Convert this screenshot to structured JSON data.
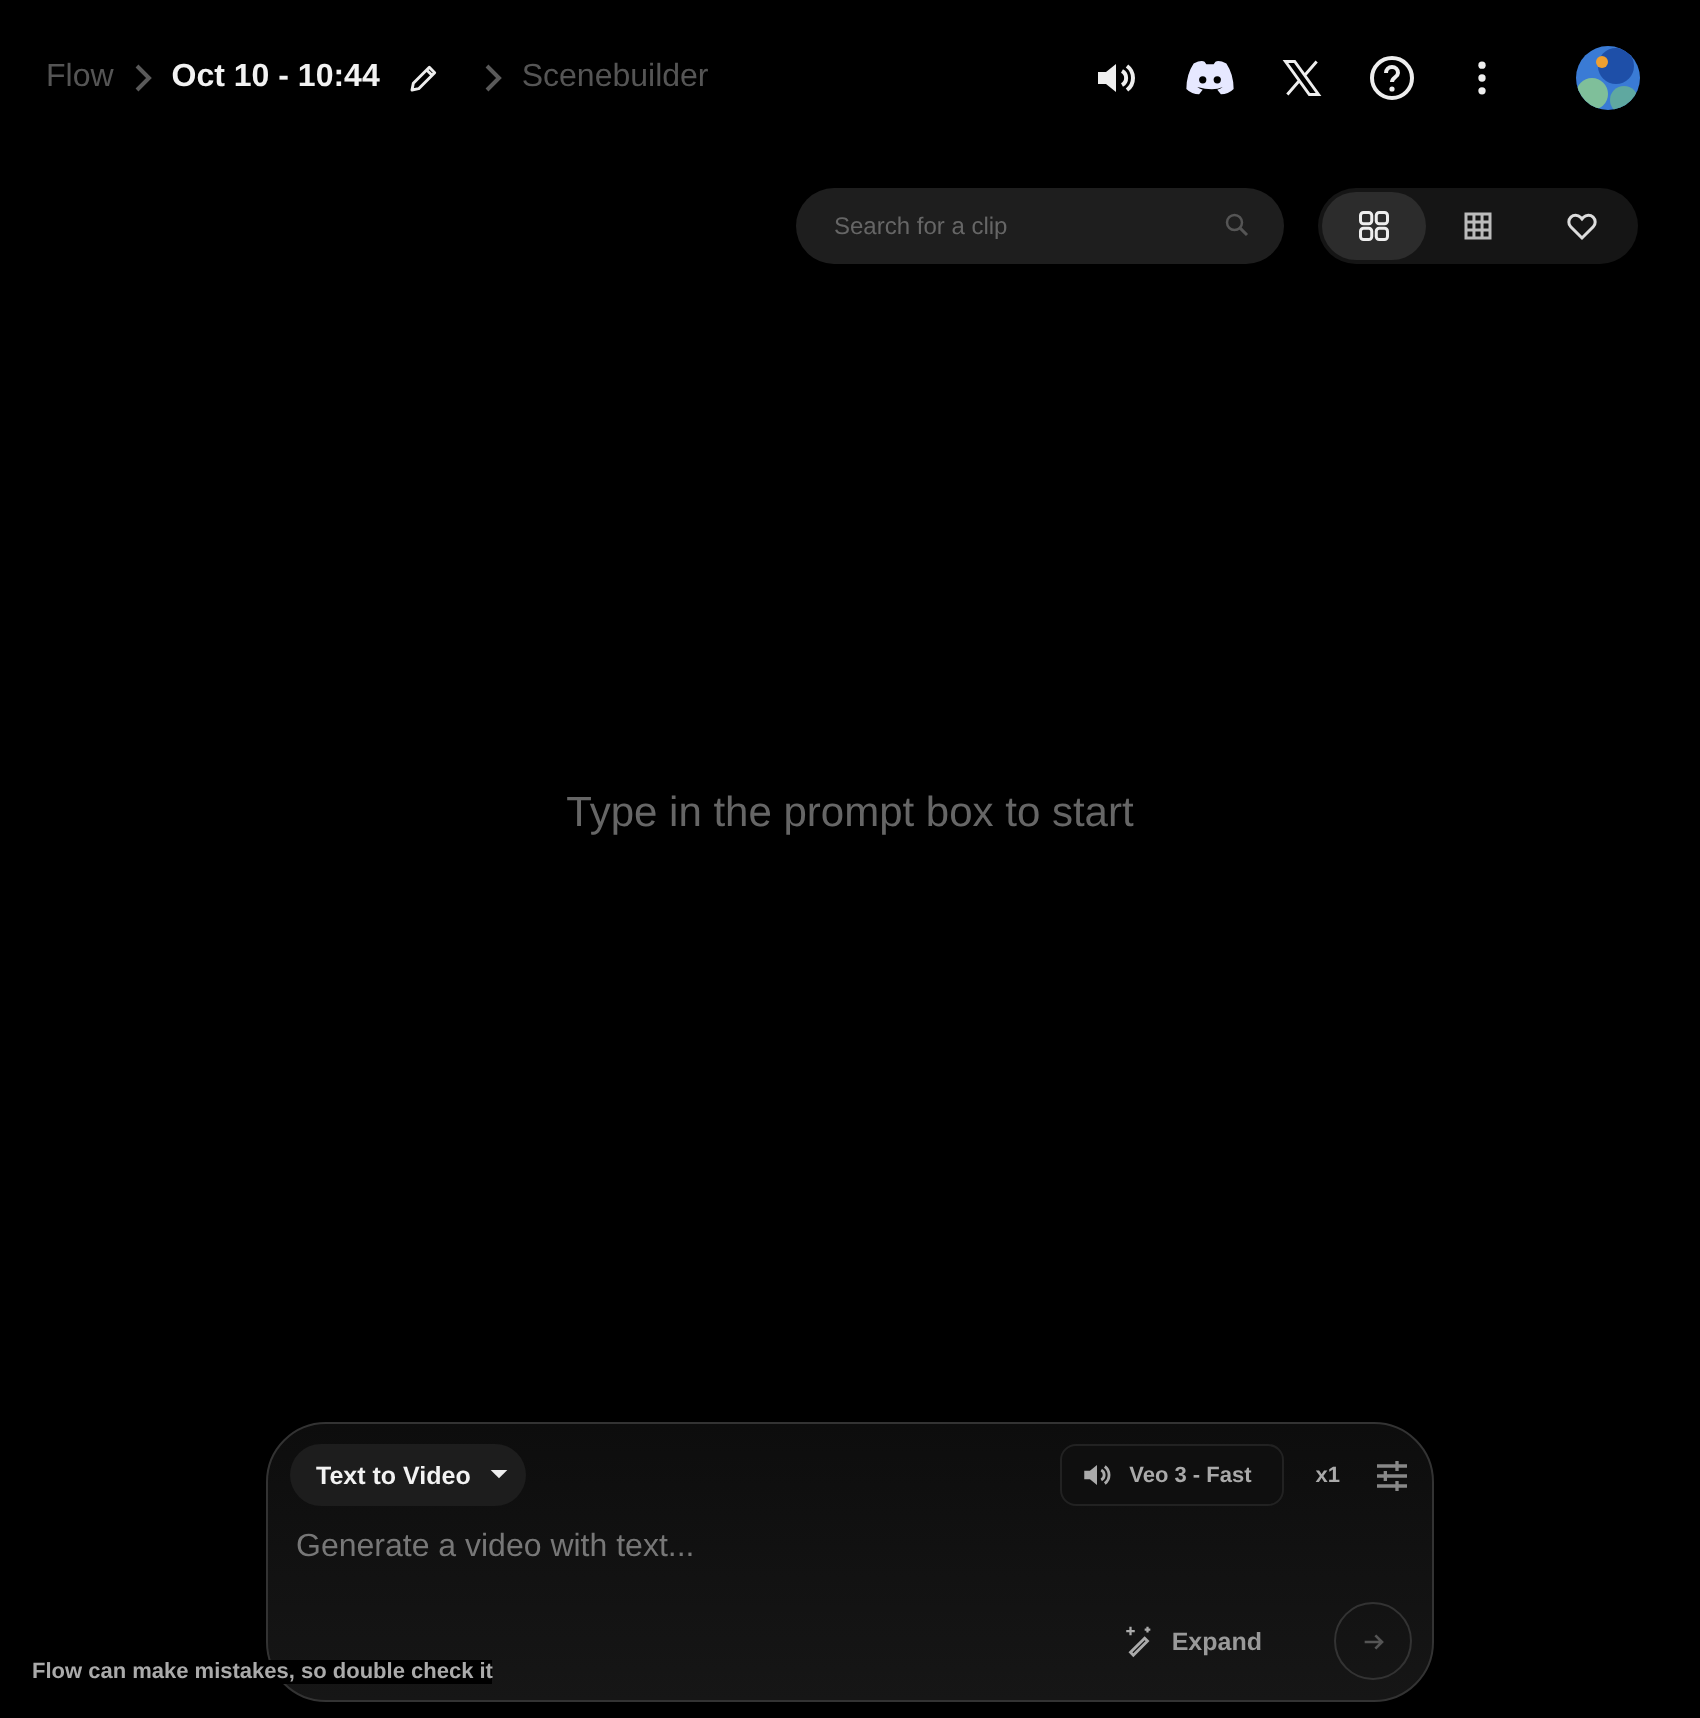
{
  "breadcrumb": [
    {
      "label": "Flow",
      "current": false
    },
    {
      "label": "Oct 10 - 10:44",
      "current": true
    },
    {
      "label": "Scenebuilder",
      "current": false
    }
  ],
  "search": {
    "placeholder": "Search for a clip"
  },
  "view_buttons": [
    {
      "kind": "grid-large",
      "selected": true
    },
    {
      "kind": "grid-small",
      "selected": false
    },
    {
      "kind": "favorites",
      "selected": false
    }
  ],
  "empty_message": "Type in the prompt box to start",
  "prompt": {
    "mode": "Text to Video",
    "model": "Veo 3 - Fast",
    "count": "x1",
    "placeholder": "Generate a video with text...",
    "expand": "Expand"
  },
  "disclaimer": "Flow can make mistakes, so double check it"
}
